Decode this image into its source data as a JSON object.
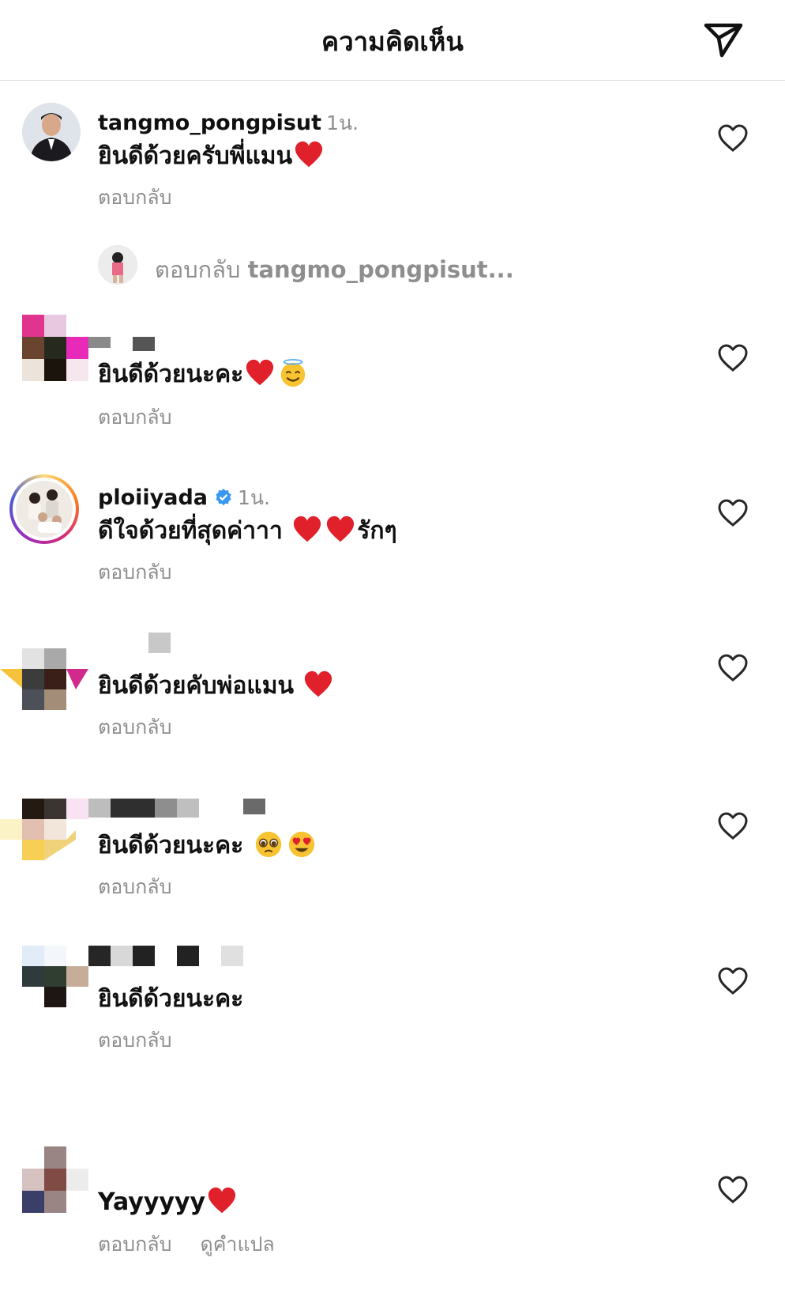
{
  "header": {
    "title": "ความคิดเห็น",
    "send_icon": "paper-plane-icon"
  },
  "comments": [
    {
      "username": "tangmo_pongpisut",
      "time": "1น.",
      "text": "ยินดีด้วยครับพี่แมน",
      "reply_label": "ตอบกลับ"
    },
    {
      "username": "",
      "text": "ยินดีด้วยนะคะ",
      "reply_label": "ตอบกลับ"
    },
    {
      "username": "ploiiyada",
      "time": "1น.",
      "text": "ดีใจด้วยที่สุดค่าาา",
      "text_suffix": "รักๆ",
      "reply_label": "ตอบกลับ"
    },
    {
      "username": "",
      "text": "ยินดีด้วยคับพ่อแมน",
      "reply_label": "ตอบกลับ"
    },
    {
      "username": "",
      "text": "ยินดีด้วยนะคะ",
      "reply_label": "ตอบกลับ"
    },
    {
      "username": "",
      "text": "ยินดีด้วยนะคะ",
      "reply_label": "ตอบกลับ"
    },
    {
      "username": "",
      "text": "Yayyyyy",
      "reply_label": "ตอบกลับ",
      "translate_label": "ดูคำแปล"
    }
  ],
  "replies_link": {
    "prefix": "ตอบกลับ",
    "username": "tangmo_pongpisut..."
  },
  "colors": {
    "muted": "#8e8e8e",
    "verified": "#3897f0",
    "heart_emoji": "#e0202a"
  }
}
